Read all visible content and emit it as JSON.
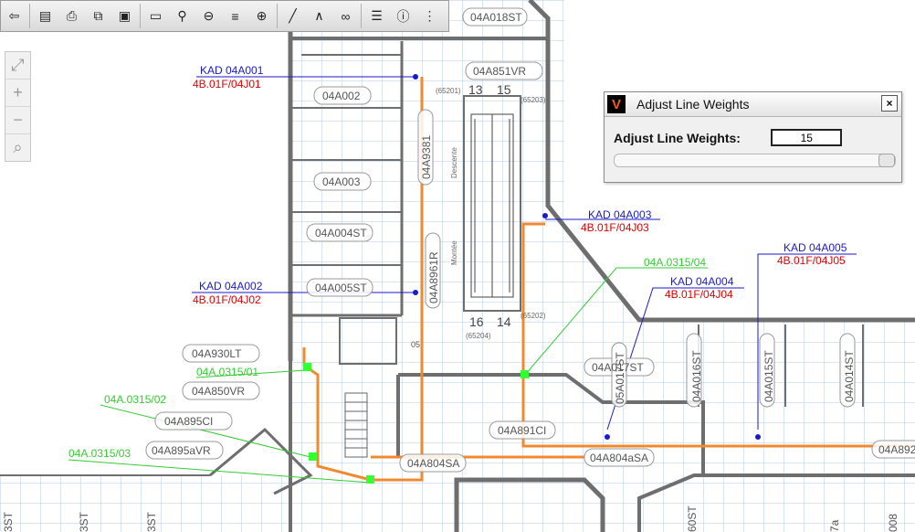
{
  "toolbar": {
    "buttons": [
      {
        "name": "back-button",
        "icon": "back-arrow-icon",
        "glyph": "⇦"
      },
      {
        "name": "layer-button",
        "icon": "layer-icon",
        "glyph": "▤"
      },
      {
        "name": "print-button",
        "icon": "printer-icon",
        "glyph": "⎙"
      },
      {
        "name": "window-button",
        "icon": "window-icon",
        "glyph": "⧉"
      },
      {
        "name": "color-window-button",
        "icon": "color-window-icon",
        "glyph": "▣"
      },
      {
        "name": "open-folder-button",
        "icon": "folder-icon",
        "glyph": "▭"
      },
      {
        "name": "zoom-text-button",
        "icon": "zoom-text-icon",
        "glyph": "⚲"
      },
      {
        "name": "layer-minus-button",
        "icon": "layer-minus-icon",
        "glyph": "⊖"
      },
      {
        "name": "layer-stack-button",
        "icon": "layer-stack-icon",
        "glyph": "≡"
      },
      {
        "name": "layer-plus-button",
        "icon": "layer-plus-icon",
        "glyph": "⊕"
      },
      {
        "name": "ruler-button",
        "icon": "ruler-icon",
        "glyph": "╱"
      },
      {
        "name": "compass-button",
        "icon": "compass-icon",
        "glyph": "∧"
      },
      {
        "name": "binoculars-button",
        "icon": "binoculars-icon",
        "glyph": "∞"
      },
      {
        "name": "line-weight-button",
        "icon": "line-weight-icon",
        "glyph": "☰"
      },
      {
        "name": "info-button",
        "icon": "info-icon",
        "glyph": "ⓘ"
      },
      {
        "name": "more-button",
        "icon": "more-vertical-icon",
        "glyph": "⋮"
      }
    ]
  },
  "zoom": {
    "extent": "⤢",
    "in": "+",
    "out": "−",
    "magnify": "⌕"
  },
  "dialog": {
    "title": "Adjust Line Weights",
    "label": "Adjust Line Weights:",
    "value": "15",
    "close": "×",
    "slider_fraction": 1.0
  },
  "colors": {
    "wall": "#6e6e6e",
    "grid": "#b3cde6",
    "route": "#f08a2e",
    "kad": "#1a1acc",
    "ref": "#e00000",
    "green": "#33cc33"
  },
  "plan": {
    "rooms": [
      "04A018ST",
      "04A851VR",
      "04A002",
      "04A003",
      "04A004ST",
      "04A005ST",
      "04A930LT",
      "04A850VR",
      "04A895CI",
      "04A895aVR",
      "04A804SA",
      "04A804aSA",
      "04A891CI",
      "04A017ST",
      "04A016ST",
      "04A015ST",
      "04A014ST",
      "04A892C",
      "04A8961R",
      "04A9381",
      "05A017ST",
      "05",
      "3ST",
      "60ST",
      "008",
      "7a"
    ],
    "kad_labels": [
      "KAD 04A001",
      "KAD 04A002",
      "KAD 04A003",
      "KAD 04A004",
      "KAD 04A005"
    ],
    "ref_labels": [
      "4B.01F/04J01",
      "4B.01F/04J02",
      "4B.01F/04J03",
      "4B.01F/04J04",
      "4B.01F/04J05"
    ],
    "green_labels": [
      "04A.0315/04",
      "04A.0315/01",
      "04A.0315/02",
      "04A.0315/03"
    ],
    "numbers": [
      "13",
      "15",
      "16",
      "14"
    ],
    "small": [
      "(65201)",
      "(65203)",
      "(65202)",
      "(65204)"
    ],
    "escalator_text": [
      "Descente",
      "Montée"
    ]
  }
}
